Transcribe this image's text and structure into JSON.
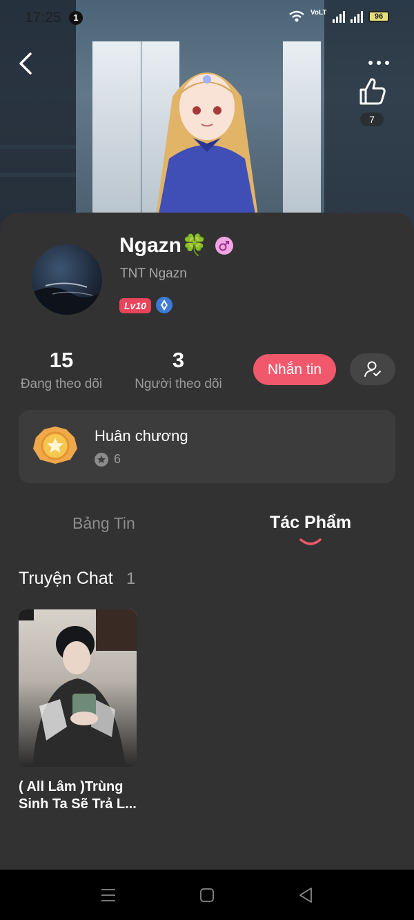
{
  "status_bar": {
    "time": "17:25",
    "notification_count": "1",
    "battery": "96",
    "network_label": "VoLTE"
  },
  "header": {
    "like_count": "7"
  },
  "profile": {
    "username": "Ngazn🍀",
    "subname": "TNT Ngazn",
    "level": "Lv10"
  },
  "stats": {
    "following_count": "15",
    "following_label": "Đang theo dõi",
    "followers_count": "3",
    "followers_label": "Người theo dõi"
  },
  "actions": {
    "message_label": "Nhắn tin"
  },
  "medal": {
    "title": "Huân chương",
    "count": "6"
  },
  "tabs": [
    {
      "label": "Bảng Tin",
      "active": false
    },
    {
      "label": "Tác Phẩm",
      "active": true
    }
  ],
  "section": {
    "title": "Truyện Chat",
    "count": "1"
  },
  "stories": [
    {
      "title": "( All Lâm )Trùng Sinh Ta Sẽ Trả L..."
    }
  ],
  "colors": {
    "accent": "#f2586c",
    "sheet_bg": "#323232",
    "card_bg": "#3c3c3c",
    "muted_text": "#9b9b9b"
  },
  "icons": [
    "back-arrow-icon",
    "more-dots-icon",
    "thumbs-up-icon",
    "gender-female-icon",
    "vip-diamond-icon",
    "follow-user-check-icon",
    "medal-icon",
    "star-icon",
    "menu-icon",
    "home-square-icon",
    "back-triangle-icon",
    "wifi-icon",
    "signal-icon",
    "battery-icon"
  ]
}
